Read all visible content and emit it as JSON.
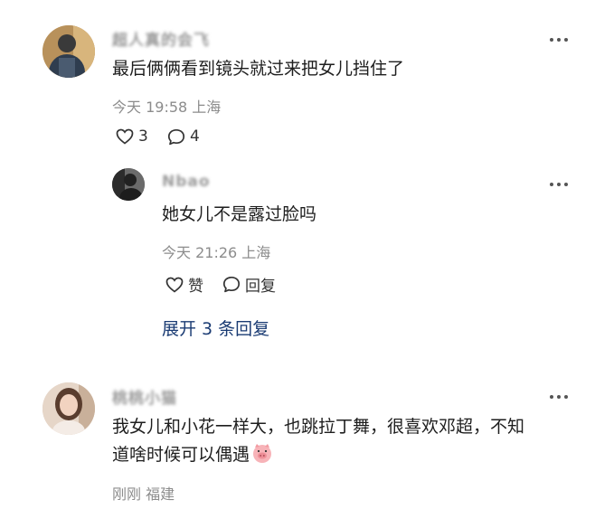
{
  "comments": [
    {
      "user": "超人真的会飞",
      "text": "最后俩俩看到镜头就过来把女儿挡住了",
      "time": "今天 19:58 上海",
      "likes": "3",
      "replies_count": "4",
      "reply": {
        "user": "Nbao",
        "text": "她女儿不是露过脸吗",
        "time": "今天 21:26 上海",
        "like_label": "赞",
        "reply_label": "回复"
      },
      "expand_label": "展开 3 条回复"
    },
    {
      "user": "桃桃小猫",
      "text_line1": "我女儿和小花一样大，也跳拉丁舞，很喜欢邓超，不知",
      "text_line2": "道啥时候可以偶遇",
      "emoji": "pig-face-emoji",
      "time": "刚刚 福建"
    }
  ],
  "icons": {
    "more": "more-dots-icon",
    "heart": "heart-icon",
    "bubble": "comment-bubble-icon"
  }
}
